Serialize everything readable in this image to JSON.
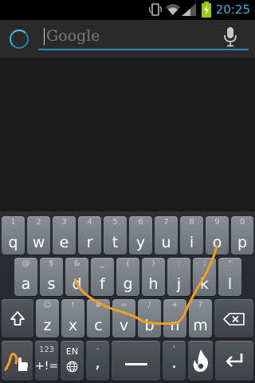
{
  "status_bar": {
    "time": "20:25",
    "icons": [
      "screen-rotate-icon",
      "wifi-icon",
      "signal-icon",
      "battery-charging-icon"
    ],
    "clock_color": "#33b5e5",
    "battery_color": "#99cc00"
  },
  "search": {
    "placeholder": "Google",
    "value": "",
    "icons": [
      "loading-spinner-icon",
      "mic-icon"
    ],
    "accent": "#33b5e5"
  },
  "keyboard": {
    "row1": [
      {
        "main": "q",
        "alt": "1"
      },
      {
        "main": "w",
        "alt": "2"
      },
      {
        "main": "e",
        "alt": "3"
      },
      {
        "main": "r",
        "alt": "4"
      },
      {
        "main": "t",
        "alt": "5"
      },
      {
        "main": "y",
        "alt": "6"
      },
      {
        "main": "u",
        "alt": "7"
      },
      {
        "main": "i",
        "alt": "8"
      },
      {
        "main": "o",
        "alt": "9"
      },
      {
        "main": "p",
        "alt": "0"
      }
    ],
    "row2": [
      {
        "main": "a",
        "alt": "@"
      },
      {
        "main": "s",
        "alt": "$"
      },
      {
        "main": "d",
        "alt": "&"
      },
      {
        "main": "f",
        "alt": "_"
      },
      {
        "main": "g",
        "alt": "("
      },
      {
        "main": "h",
        "alt": ")"
      },
      {
        "main": "j",
        "alt": ":"
      },
      {
        "main": "k",
        "alt": ";"
      },
      {
        "main": "l",
        "alt": "\""
      }
    ],
    "row3": [
      {
        "main": "z",
        "alt": "☺"
      },
      {
        "main": "x",
        "alt": "!"
      },
      {
        "main": "c",
        "alt": "#"
      },
      {
        "main": "v",
        "alt": "="
      },
      {
        "main": "b",
        "alt": "/"
      },
      {
        "main": "n",
        "alt": "+"
      },
      {
        "main": "m",
        "alt": "?"
      }
    ],
    "row4": {
      "numbers_top": "123",
      "numbers_bottom": "+!=",
      "lang": "EN",
      "comma": ",",
      "comma_alt": "-",
      "period": ".",
      "period_alt": "'"
    },
    "special_icons": [
      "shift-icon",
      "backspace-icon",
      "swype-icon",
      "globe-icon",
      "space-bar-icon",
      "dragon-voice-icon",
      "enter-icon"
    ],
    "trace_color": "#f0a020"
  }
}
